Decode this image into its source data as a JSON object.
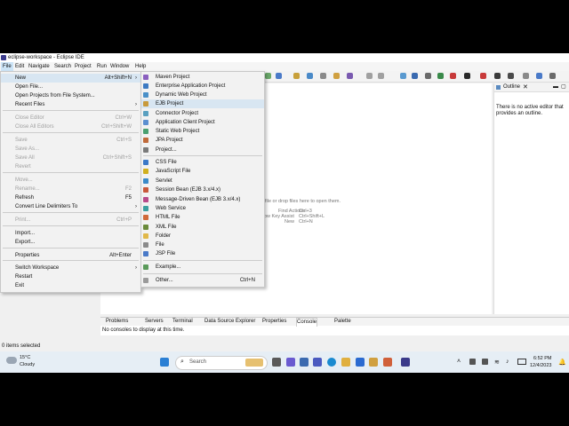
{
  "window": {
    "title": "eclipse-workspace - Eclipse IDE"
  },
  "menubar": [
    "File",
    "Edit",
    "Navigate",
    "Search",
    "Project",
    "Run",
    "Window",
    "Help"
  ],
  "file_menu": [
    {
      "label": "New",
      "shortcut": "Alt+Shift+N",
      "arrow": true,
      "disabled": false,
      "highlight": true
    },
    {
      "label": "Open File...",
      "shortcut": "",
      "disabled": false
    },
    {
      "label": "Open Projects from File System...",
      "shortcut": "",
      "disabled": false
    },
    {
      "label": "Recent Files",
      "shortcut": "",
      "arrow": true,
      "disabled": false
    },
    {
      "label": "Close Editor",
      "shortcut": "Ctrl+W",
      "disabled": true
    },
    {
      "label": "Close All Editors",
      "shortcut": "Ctrl+Shift+W",
      "disabled": true
    },
    {
      "label": "Save",
      "shortcut": "Ctrl+S",
      "disabled": true
    },
    {
      "label": "Save As...",
      "shortcut": "",
      "disabled": true
    },
    {
      "label": "Save All",
      "shortcut": "Ctrl+Shift+S",
      "disabled": true
    },
    {
      "label": "Revert",
      "shortcut": "",
      "disabled": true
    },
    {
      "label": "Move...",
      "shortcut": "",
      "disabled": true
    },
    {
      "label": "Rename...",
      "shortcut": "F2",
      "disabled": true
    },
    {
      "label": "Refresh",
      "shortcut": "F5",
      "disabled": false
    },
    {
      "label": "Convert Line Delimiters To",
      "shortcut": "",
      "arrow": true,
      "disabled": false
    },
    {
      "label": "Print...",
      "shortcut": "Ctrl+P",
      "disabled": true
    },
    {
      "label": "Import...",
      "shortcut": "",
      "disabled": false
    },
    {
      "label": "Export...",
      "shortcut": "",
      "disabled": false
    },
    {
      "label": "Properties",
      "shortcut": "Alt+Enter",
      "disabled": false
    },
    {
      "label": "Switch Workspace",
      "shortcut": "",
      "arrow": true,
      "disabled": false
    },
    {
      "label": "Restart",
      "shortcut": "",
      "disabled": false
    },
    {
      "label": "Exit",
      "shortcut": "",
      "disabled": false
    }
  ],
  "new_submenu": [
    {
      "label": "Maven Project",
      "color": "#8a5fbf"
    },
    {
      "label": "Enterprise Application Project",
      "color": "#3d7ac2"
    },
    {
      "label": "Dynamic Web Project",
      "color": "#4a90c8"
    },
    {
      "label": "EJB Project",
      "color": "#c89a3c"
    },
    {
      "label": "Connector Project",
      "color": "#5aa0c0"
    },
    {
      "label": "Application Client Project",
      "color": "#5b8fd0"
    },
    {
      "label": "Static Web Project",
      "color": "#4aa070"
    },
    {
      "label": "JPA Project",
      "color": "#c06a3a"
    },
    {
      "label": "Project...",
      "color": "#7a7a7a"
    },
    {
      "label": "CSS File",
      "color": "#3a78c8"
    },
    {
      "label": "JavaScript File",
      "color": "#d0b020"
    },
    {
      "label": "Servlet",
      "color": "#3a8ac8"
    },
    {
      "label": "Session Bean (EJB 3.x/4.x)",
      "color": "#c8583a"
    },
    {
      "label": "Message-Driven Bean (EJB 3.x/4.x)",
      "color": "#b84a8a"
    },
    {
      "label": "Web Service",
      "color": "#3aa0a0"
    },
    {
      "label": "HTML File",
      "color": "#d06a3a"
    },
    {
      "label": "XML File",
      "color": "#6a8a3a"
    },
    {
      "label": "Folder",
      "color": "#e0b84a"
    },
    {
      "label": "File",
      "color": "#8a8a8a"
    },
    {
      "label": "JSP File",
      "color": "#4a7ac8"
    },
    {
      "label": "Example...",
      "color": "#5a9a5a"
    },
    {
      "label": "Other...",
      "shortcut": "Ctrl+N",
      "color": "#9a9a9a"
    }
  ],
  "outline": {
    "tab": "Outline",
    "message": "There is no active editor that provides an outline."
  },
  "editor_hint": {
    "drop": "file or drop files here to open them.",
    "lines": [
      {
        "label": "Find Actions",
        "key": "Ctrl+3"
      },
      {
        "label": "ow Key Assist",
        "key": "Ctrl+Shift+L"
      },
      {
        "label": "New",
        "key": "Ctrl+N"
      }
    ]
  },
  "bottom_tabs": [
    "Problems",
    "Servers",
    "Terminal",
    "Data Source Explorer",
    "Properties",
    "Console",
    "Palette"
  ],
  "console_message": "No consoles to display at this time.",
  "status": {
    "text": "0 items selected"
  },
  "taskbar": {
    "weather_temp": "15°C",
    "weather_desc": "Cloudy",
    "search_placeholder": "Search",
    "time": "6:52 PM",
    "date": "12/4/2023"
  }
}
